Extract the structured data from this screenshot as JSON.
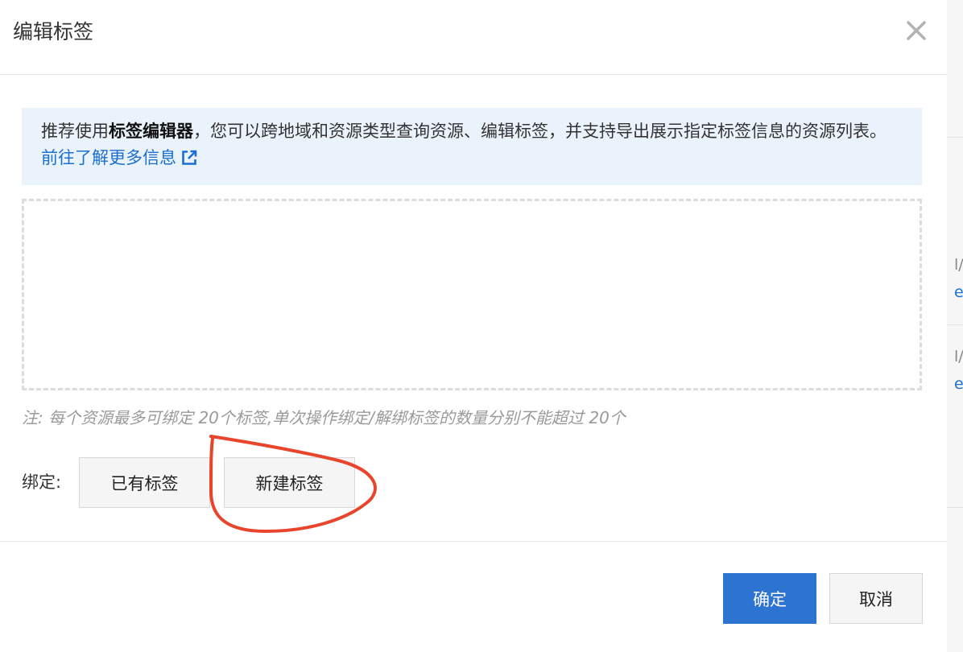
{
  "dialog": {
    "title": "编辑标签",
    "close_icon": "close-icon"
  },
  "info": {
    "prefix": "推荐使用",
    "bold": "标签编辑器",
    "suffix": "，您可以跨地域和资源类型查询资源、编辑标签，并支持导出展示指定标签信息的资源列表。",
    "link": "前往了解更多信息",
    "link_icon": "external-link-icon"
  },
  "note": "注: 每个资源最多可绑定 20个标签,单次操作绑定/解绑标签的数量分别不能超过 20个",
  "bind": {
    "label": "绑定:",
    "existing_button": "已有标签",
    "new_button": "新建标签"
  },
  "footer": {
    "ok": "确定",
    "cancel": "取消"
  },
  "background_fragments": [
    "l/",
    "e",
    "l/",
    "e"
  ],
  "colors": {
    "primary": "#2c73d2",
    "link": "#1b6fd0",
    "info_bg": "#eaf3fc",
    "annotation": "#e8452c"
  }
}
